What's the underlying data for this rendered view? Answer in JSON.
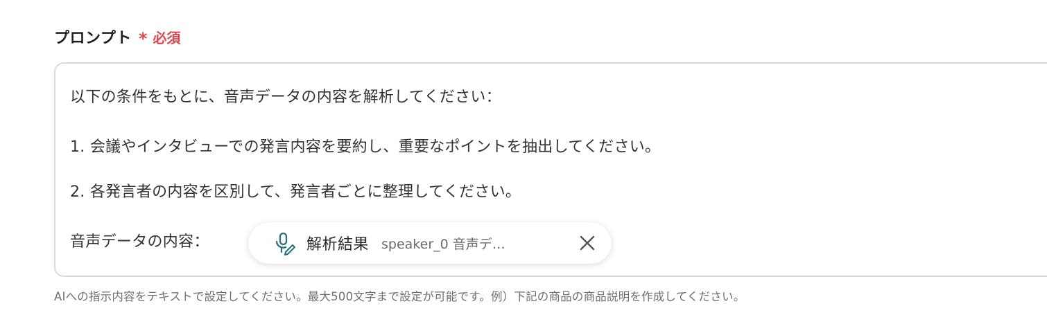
{
  "field": {
    "label": "プロンプト",
    "required_marker": "*",
    "required_text": "必須",
    "content": {
      "line1": "以下の条件をもとに、音声データの内容を解析してください：",
      "line2": "1. 会議やインタビューでの発言内容を要約し、重要なポイントを抽出してください。",
      "line3": "2. 各発言者の内容を区別して、発言者ごとに整理してください。",
      "line4_prefix": "音声データの内容："
    },
    "chip": {
      "icon": "microphone-pen-icon",
      "title": "解析結果",
      "value": "speaker_0 音声デ…",
      "close_icon": "close-icon",
      "icon_color": "#2a6f7a"
    },
    "help": "AIへの指示内容をテキストで設定してください。最大500文字まで設定が可能です。例）下記の商品の商品説明を作成してください。"
  },
  "colors": {
    "required": "#e0464f",
    "border": "#d9d9d9",
    "text": "#333333",
    "help_text": "#6f6f6f"
  }
}
